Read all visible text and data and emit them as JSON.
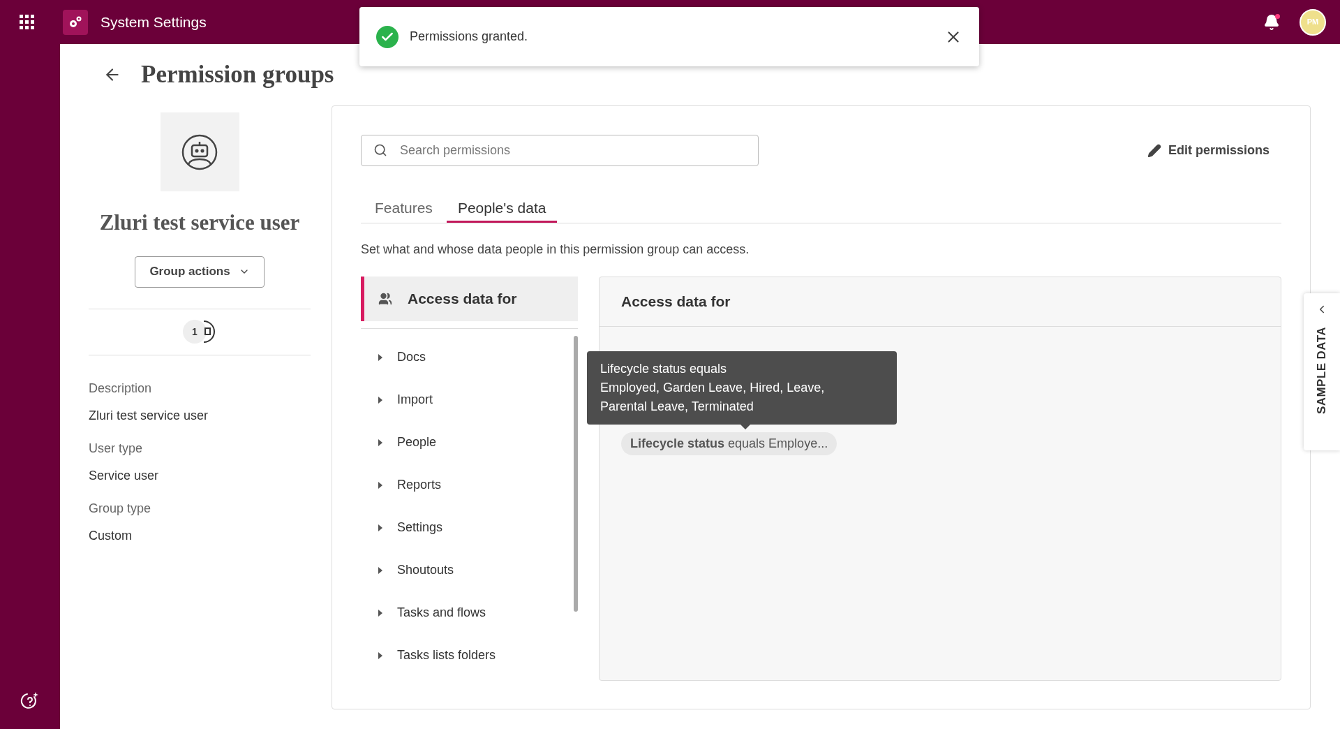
{
  "top_bar": {
    "title": "System Settings",
    "avatar_initials": "PM",
    "notification_unread": true
  },
  "toast": {
    "message": "Permissions granted."
  },
  "page": {
    "title": "Permission groups"
  },
  "group": {
    "name": "Zluri test service user",
    "actions_button": "Group actions",
    "member_count": "1",
    "details": [
      {
        "label": "Description",
        "value": "Zluri test service user"
      },
      {
        "label": "User type",
        "value": "Service user"
      },
      {
        "label": "Group type",
        "value": "Custom"
      }
    ]
  },
  "search": {
    "placeholder": "Search permissions"
  },
  "edit_button": "Edit permissions",
  "tabs": [
    {
      "label": "Features",
      "selected": false
    },
    {
      "label": "People's data",
      "selected": true
    }
  ],
  "description": "Set what and whose data people in this permission group can access.",
  "section_nav": {
    "active": {
      "label": "Access data for",
      "selected": true
    },
    "items": [
      {
        "label": "Docs",
        "expanded": false
      },
      {
        "label": "Import",
        "expanded": false
      },
      {
        "label": "People",
        "expanded": false
      },
      {
        "label": "Reports",
        "expanded": false
      },
      {
        "label": "Settings",
        "expanded": false
      },
      {
        "label": "Shoutouts",
        "expanded": false
      },
      {
        "label": "Tasks and flows",
        "expanded": false
      },
      {
        "label": "Tasks lists folders",
        "expanded": false
      }
    ]
  },
  "panel": {
    "title": "Access data for",
    "chip": "**Lifecycle status** equals Employe...",
    "tooltip": [
      "Lifecycle status equals",
      "Employed, Garden Leave, Hired, Leave,",
      "Parental Leave, Terminated"
    ]
  },
  "sample_data": "SAMPLE DATA"
}
